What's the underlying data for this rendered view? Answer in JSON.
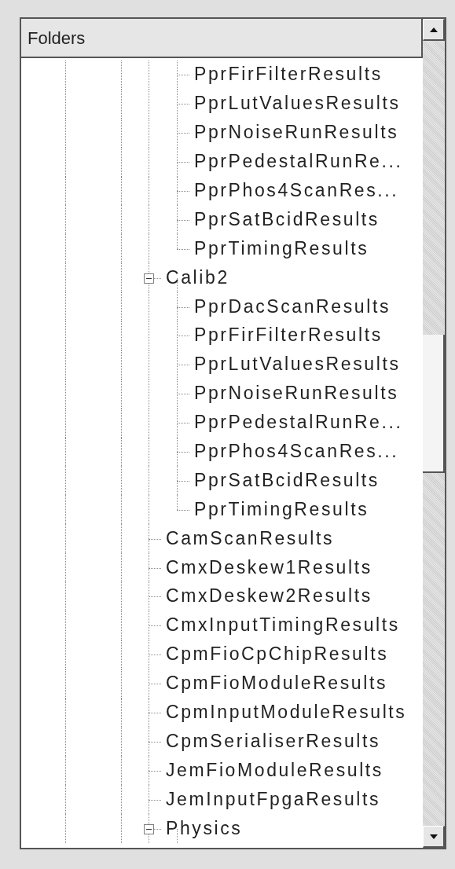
{
  "header": {
    "title": "Folders"
  },
  "tree": {
    "continued_children": [
      {
        "label": "PprFirFilterResults"
      },
      {
        "label": "PprLutValuesResults"
      },
      {
        "label": "PprNoiseRunResults"
      },
      {
        "label": "PprPedestalRunRe..."
      },
      {
        "label": "PprPhos4ScanRes..."
      },
      {
        "label": "PprSatBcidResults"
      },
      {
        "label": "PprTimingResults"
      }
    ],
    "items": [
      {
        "label": "Calib2",
        "expanded": true,
        "children": [
          {
            "label": "PprDacScanResults"
          },
          {
            "label": "PprFirFilterResults"
          },
          {
            "label": "PprLutValuesResults"
          },
          {
            "label": "PprNoiseRunResults"
          },
          {
            "label": "PprPedestalRunRe..."
          },
          {
            "label": "PprPhos4ScanRes..."
          },
          {
            "label": "PprSatBcidResults"
          },
          {
            "label": "PprTimingResults"
          }
        ]
      },
      {
        "label": "CamScanResults"
      },
      {
        "label": "CmxDeskew1Results"
      },
      {
        "label": "CmxDeskew2Results"
      },
      {
        "label": "CmxInputTimingResults"
      },
      {
        "label": "CpmFioCpChipResults"
      },
      {
        "label": "CpmFioModuleResults"
      },
      {
        "label": "CpmInputModuleResults"
      },
      {
        "label": "CpmSerialiserResults"
      },
      {
        "label": "JemFioModuleResults"
      },
      {
        "label": "JemInputFpgaResults"
      },
      {
        "label": "Physics",
        "expanded": true
      }
    ]
  }
}
